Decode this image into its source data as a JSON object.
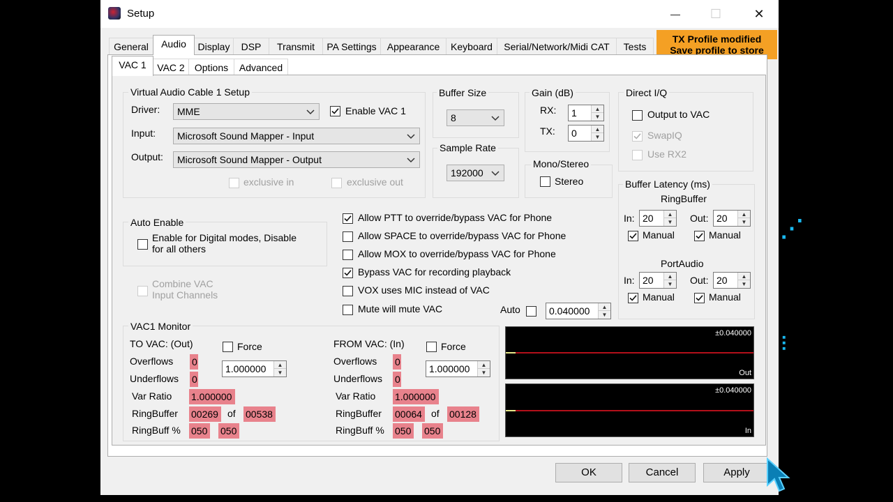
{
  "window": {
    "title": "Setup",
    "minimize_glyph": "—",
    "maximize_glyph": "☐",
    "close_glyph": "✕"
  },
  "main_tabs": [
    "General",
    "Audio",
    "Display",
    "DSP",
    "Transmit",
    "PA Settings",
    "Appearance",
    "Keyboard",
    "Serial/Network/Midi CAT",
    "Tests"
  ],
  "notice": {
    "line1": "TX Profile modified",
    "line2": "Save profile to store"
  },
  "sub_tabs": [
    "VAC 1",
    "VAC 2",
    "Options",
    "Advanced"
  ],
  "vac_setup": {
    "title": "Virtual Audio Cable 1 Setup",
    "driver_label": "Driver:",
    "driver_value": "MME",
    "enable_label": "Enable VAC 1",
    "input_label": "Input:",
    "input_value": "Microsoft Sound Mapper - Input",
    "output_label": "Output:",
    "output_value": "Microsoft Sound Mapper - Output",
    "exclusive_in": "exclusive in",
    "exclusive_out": "exclusive out"
  },
  "buffer_size": {
    "title": "Buffer Size",
    "value": "8"
  },
  "sample_rate": {
    "title": "Sample Rate",
    "value": "192000"
  },
  "gain": {
    "title": "Gain (dB)",
    "rx_label": "RX:",
    "rx_value": "1",
    "tx_label": "TX:",
    "tx_value": "0"
  },
  "mono_stereo": {
    "title": "Mono/Stereo",
    "stereo_label": "Stereo"
  },
  "direct_iq": {
    "title": "Direct I/Q",
    "output_to_vac": "Output to VAC",
    "swap_iq": "SwapIQ",
    "use_rx2": "Use RX2"
  },
  "buffer_latency": {
    "title": "Buffer Latency (ms)",
    "ring_title": "RingBuffer",
    "port_title": "PortAudio",
    "in_label": "In:",
    "out_label": "Out:",
    "ring_in": "20",
    "ring_out": "20",
    "port_in": "20",
    "port_out": "20",
    "manual_label": "Manual"
  },
  "auto_enable": {
    "title": "Auto Enable",
    "line1": "Enable for Digital modes, Disable",
    "line2": "for all others"
  },
  "combine": {
    "line1": "Combine VAC",
    "line2": "Input Channels"
  },
  "options": {
    "ptt": "Allow PTT to override/bypass VAC for Phone",
    "space": "Allow SPACE to override/bypass VAC for Phone",
    "mox": "Allow MOX to override/bypass VAC for Phone",
    "bypass": "Bypass VAC for recording playback",
    "vox": "VOX uses MIC instead of VAC",
    "mute": "Mute will mute VAC",
    "auto_label": "Auto",
    "auto_value": "0.040000"
  },
  "monitor": {
    "title": "VAC1 Monitor",
    "to_vac": {
      "title": "TO VAC: (Out)",
      "force_label": "Force",
      "spin_value": "1.000000",
      "overflows_label": "Overflows",
      "overflows": "0",
      "underflows_label": "Underflows",
      "underflows": "0",
      "var_ratio_label": "Var Ratio",
      "var_ratio": "1.000000",
      "ringbuffer_label": "RingBuffer",
      "ring_a": "00269",
      "of_label": "of",
      "ring_b": "00538",
      "ringbuff_pct_label": "RingBuff %",
      "pct_a": "050",
      "pct_b": "050"
    },
    "from_vac": {
      "title": "FROM VAC: (In)",
      "force_label": "Force",
      "spin_value": "1.000000",
      "overflows_label": "Overflows",
      "overflows": "0",
      "underflows_label": "Underflows",
      "underflows": "0",
      "var_ratio_label": "Var Ratio",
      "var_ratio": "1.000000",
      "ringbuffer_label": "RingBuffer",
      "ring_a": "00064",
      "of_label": "of",
      "ring_b": "00128",
      "ringbuff_pct_label": "RingBuff %",
      "pct_a": "050",
      "pct_b": "050"
    }
  },
  "scopes": {
    "out_top": "±0.040000",
    "out_label": "Out",
    "in_top": "±0.040000",
    "in_label": "In"
  },
  "buttons": {
    "ok": "OK",
    "cancel": "Cancel",
    "apply": "Apply"
  },
  "checked": {
    "enable_vac": true,
    "ptt": true,
    "bypass": true,
    "ring_manual_in": true,
    "ring_manual_out": true,
    "port_manual_in": true,
    "port_manual_out": true,
    "swap_iq": true
  },
  "colors": {
    "notice": "#f4a024",
    "monitor_value_bg": "#e8828c",
    "scope_line": "#b3101a"
  }
}
